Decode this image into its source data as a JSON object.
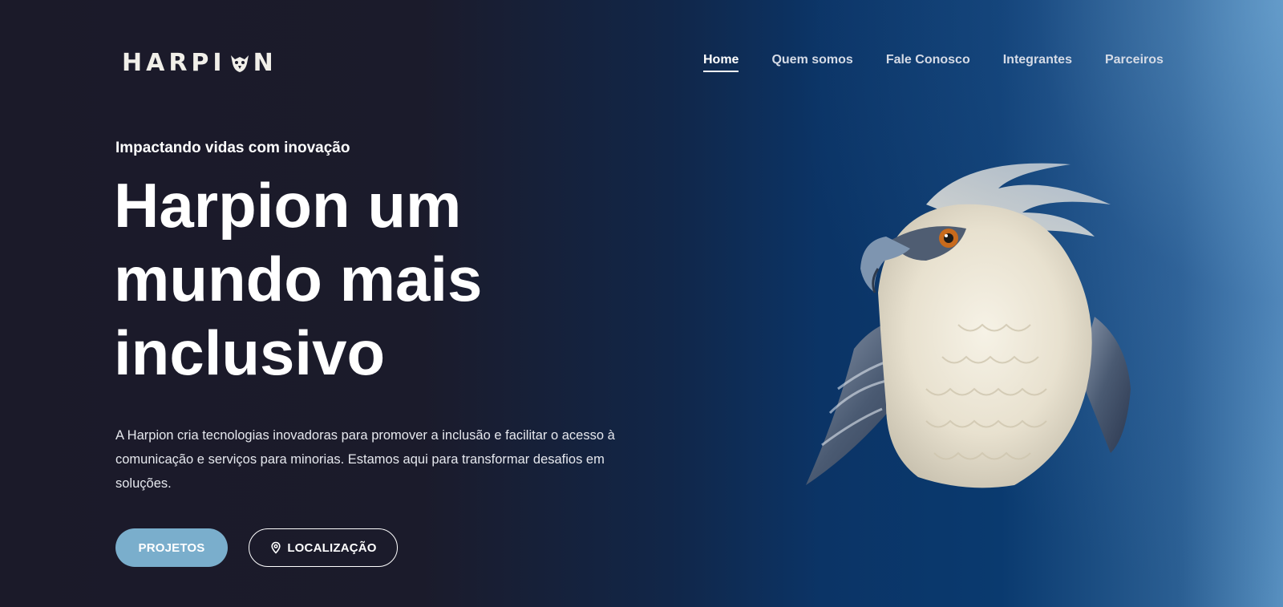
{
  "header": {
    "logo_text_left": "HARPI",
    "logo_text_right": "N",
    "logo_text": "HARPION",
    "nav": [
      {
        "label": "Home",
        "active": true
      },
      {
        "label": "Quem somos",
        "active": false
      },
      {
        "label": "Fale Conosco",
        "active": false
      },
      {
        "label": "Integrantes",
        "active": false
      },
      {
        "label": "Parceiros",
        "active": false
      }
    ]
  },
  "hero": {
    "tagline": "Impactando vidas com inovação",
    "headline": "Harpion um mundo mais inclusivo",
    "description": "A Harpion cria tecnologias inovadoras para promover a inclusão e facilitar o acesso à comunicação e serviços para minorias. Estamos aqui para transformar desafios em soluções.",
    "buttons": {
      "projetos_label": "PROJETOS",
      "localizacao_label": "LOCALIZAÇÃO",
      "localizacao_icon": "map-pin-icon"
    },
    "image": "harpy-eagle-illustration"
  },
  "colors": {
    "background_dark": "#1b1a29",
    "background_blue": "#0a3a6f",
    "accent_button": "#7aaecc",
    "text": "#ffffff"
  }
}
